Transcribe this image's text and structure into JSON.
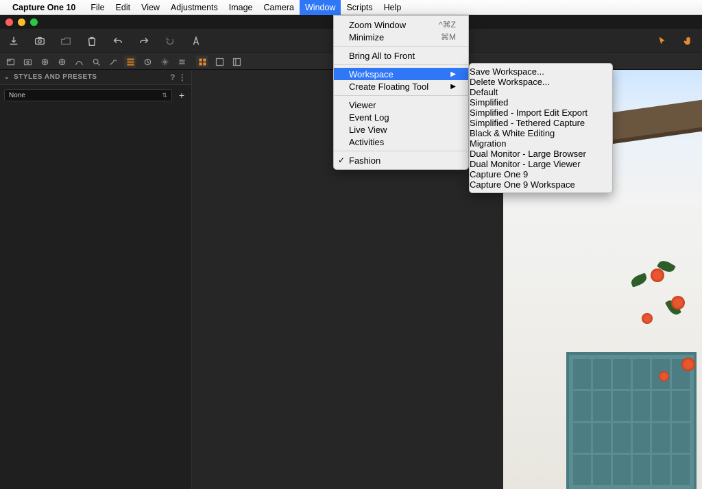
{
  "menubar": {
    "app_name": "Capture One 10",
    "items": [
      "File",
      "Edit",
      "View",
      "Adjustments",
      "Image",
      "Camera",
      "Window",
      "Scripts",
      "Help"
    ],
    "active_index": 6
  },
  "toolbar_icons": [
    "import-icon",
    "camera-icon",
    "folder-open-icon",
    "trash-icon",
    "undo-icon",
    "redo-icon",
    "reset-icon",
    "text-tool-icon"
  ],
  "toolbar_right_icons": [
    "cursor-icon",
    "hand-icon"
  ],
  "tooltabs_left": [
    "library-icon",
    "capture-icon",
    "lens-icon",
    "color-icon",
    "exposure-icon",
    "search-icon",
    "spot-icon",
    "styles-icon",
    "metadata-icon",
    "gear-icon",
    "adjust-icon"
  ],
  "tooltabs_left_active": 7,
  "tooltabs_right": [
    "grid-icon",
    "single-icon",
    "panel-icon"
  ],
  "panel": {
    "title": "STYLES AND PRESETS",
    "help_icon": "?",
    "action_icon": "⋯",
    "select_value": "None",
    "add_label": "+"
  },
  "window_menu": {
    "items": [
      {
        "label": "Zoom Window",
        "shortcut": "^⌘Z"
      },
      {
        "label": "Minimize",
        "shortcut": "⌘M"
      },
      {
        "sep": true
      },
      {
        "label": "Bring All to Front"
      },
      {
        "sep": true
      },
      {
        "label": "Workspace",
        "submenu": true,
        "highlight": true
      },
      {
        "label": "Create Floating Tool",
        "submenu": true
      },
      {
        "sep": true
      },
      {
        "label": "Viewer"
      },
      {
        "label": "Event Log"
      },
      {
        "label": "Live View"
      },
      {
        "label": "Activities"
      },
      {
        "sep": true
      },
      {
        "label": "Fashion",
        "checked": true
      }
    ]
  },
  "workspace_submenu": {
    "items": [
      {
        "label": "Save Workspace..."
      },
      {
        "label": "Delete Workspace..."
      },
      {
        "sep": true
      },
      {
        "label": "Default",
        "highlight": true
      },
      {
        "label": "Simplified"
      },
      {
        "label": "Simplified - Import Edit Export"
      },
      {
        "label": "Simplified - Tethered Capture"
      },
      {
        "label": "Black & White Editing"
      },
      {
        "label": "Migration"
      },
      {
        "label": "Dual Monitor - Large Browser"
      },
      {
        "label": "Dual Monitor - Large Viewer"
      },
      {
        "label": "Capture One 9"
      },
      {
        "sep": true
      },
      {
        "label": "Capture One 9 Workspace"
      }
    ]
  }
}
